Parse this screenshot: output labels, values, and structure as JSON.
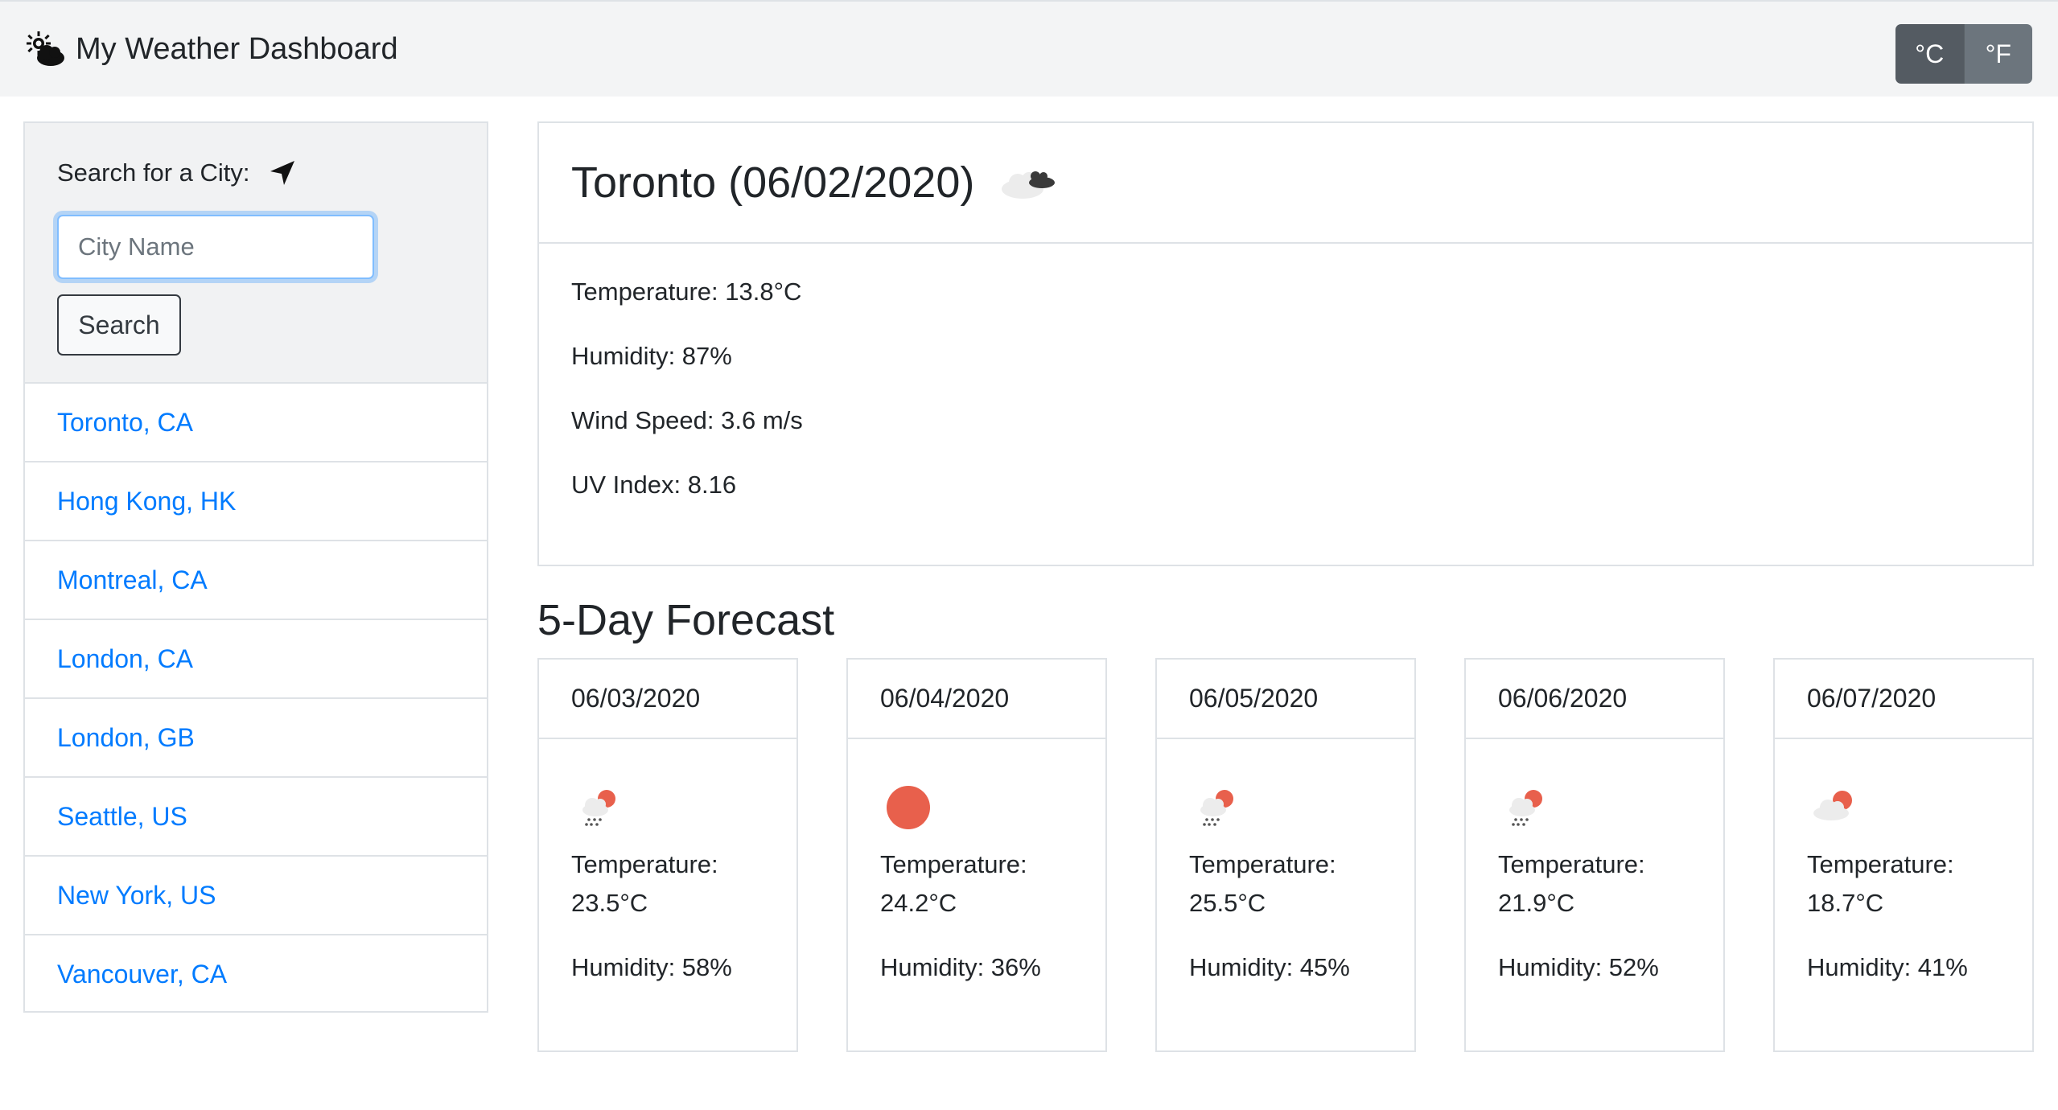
{
  "navbar": {
    "title": "My Weather Dashboard",
    "brand_icon": "cloud-sun-icon",
    "units": {
      "celsius": "°C",
      "fahrenheit": "°F",
      "active": "celsius"
    }
  },
  "sidebar": {
    "search_label": "Search for a City:",
    "locate_icon": "location-arrow-icon",
    "input_placeholder": "City Name",
    "input_value": "",
    "search_button": "Search",
    "cities": [
      "Toronto, CA",
      "Hong Kong, HK",
      "Montreal, CA",
      "London, CA",
      "London, GB",
      "Seattle, US",
      "New York, US",
      "Vancouver, CA"
    ]
  },
  "current": {
    "title": "Toronto (06/02/2020)",
    "icon": "broken-clouds-icon",
    "temperature": "Temperature: 13.8°C",
    "humidity": "Humidity: 87%",
    "wind": "Wind Speed: 3.6 m/s",
    "uv": "UV Index: 8.16"
  },
  "forecast": {
    "title": "5-Day Forecast",
    "days": [
      {
        "date": "06/03/2020",
        "icon": "rain-sun-icon",
        "temp_label": "Temperature:",
        "temp": "23.5°C",
        "humidity": "Humidity: 58%"
      },
      {
        "date": "06/04/2020",
        "icon": "clear-sun-icon",
        "temp_label": "Temperature:",
        "temp": "24.2°C",
        "humidity": "Humidity: 36%"
      },
      {
        "date": "06/05/2020",
        "icon": "rain-sun-icon",
        "temp_label": "Temperature:",
        "temp": "25.5°C",
        "humidity": "Humidity: 45%"
      },
      {
        "date": "06/06/2020",
        "icon": "rain-sun-icon",
        "temp_label": "Temperature:",
        "temp": "21.9°C",
        "humidity": "Humidity: 52%"
      },
      {
        "date": "06/07/2020",
        "icon": "cloud-sun-icon",
        "temp_label": "Temperature:",
        "temp": "18.7°C",
        "humidity": "Humidity: 41%"
      }
    ]
  },
  "colors": {
    "link": "#007bff",
    "sun": "#e8604c",
    "navbar_bg": "#f3f4f5",
    "unit_active": "#545b62",
    "unit_inactive": "#6c757d"
  }
}
